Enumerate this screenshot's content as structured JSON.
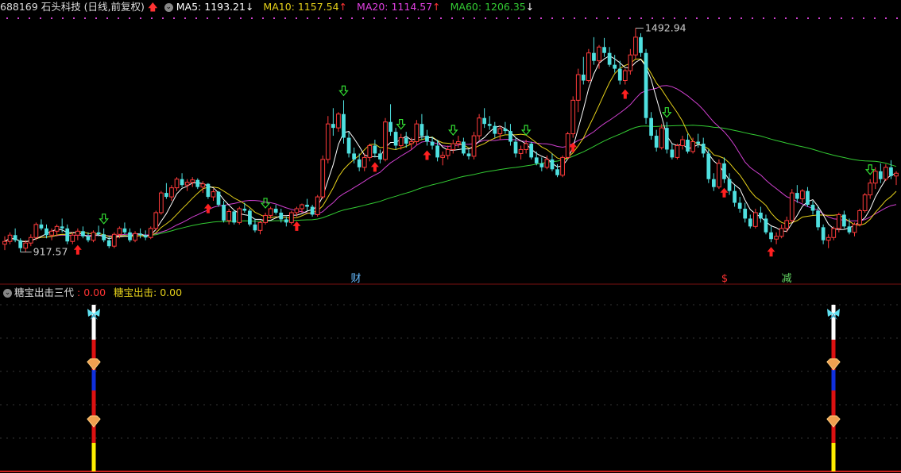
{
  "header": {
    "stock": "688169 石头科技 (日线,前复权)",
    "ma": [
      {
        "label": "MA5: 1193.21",
        "color": "#ffffff",
        "arrow": "↓",
        "arrow_color": "#ffffff"
      },
      {
        "label": "MA10: 1157.54",
        "color": "#e6d11a",
        "arrow": "↑",
        "arrow_color": "#ff3333"
      },
      {
        "label": "MA20: 1114.57",
        "color": "#e040e0",
        "arrow": "↑",
        "arrow_color": "#ff3333"
      },
      {
        "label": "MA60: 1206.35",
        "color": "#33cc33",
        "arrow": "↓",
        "arrow_color": "#ffffff"
      }
    ]
  },
  "indicator_header": {
    "name": "糖宝出击三代",
    "v1_label": "0.00",
    "v2_name": "糖宝出击:",
    "v2_label": "0.00"
  },
  "markers": [
    {
      "text": "财",
      "color": "#66bbff"
    },
    {
      "text": "$",
      "color": "#ff3333"
    },
    {
      "text": "减",
      "color": "#66dd66"
    }
  ],
  "chart_data": {
    "type": "candlestick",
    "ylim": [
      880,
      1520
    ],
    "annotations": [
      {
        "label": "1492.94",
        "type": "high"
      },
      {
        "label": "917.57",
        "type": "low"
      }
    ],
    "candles": [
      [
        945,
        965,
        930,
        952
      ],
      [
        952,
        975,
        945,
        968
      ],
      [
        968,
        985,
        950,
        955
      ],
      [
        955,
        960,
        925,
        935
      ],
      [
        935,
        955,
        925,
        948
      ],
      [
        948,
        970,
        940,
        962
      ],
      [
        962,
        1000,
        955,
        995
      ],
      [
        995,
        1008,
        980,
        985
      ],
      [
        985,
        995,
        960,
        968
      ],
      [
        968,
        985,
        955,
        978
      ],
      [
        978,
        995,
        965,
        990
      ],
      [
        990,
        1010,
        975,
        985
      ],
      [
        985,
        995,
        945,
        952
      ],
      [
        952,
        975,
        945,
        968
      ],
      [
        968,
        985,
        955,
        978
      ],
      [
        978,
        990,
        960,
        965
      ],
      [
        965,
        975,
        950,
        955
      ],
      [
        955,
        980,
        950,
        975
      ],
      [
        975,
        992,
        965,
        970
      ],
      [
        970,
        985,
        950,
        955
      ],
      [
        955,
        965,
        935,
        940
      ],
      [
        940,
        975,
        935,
        970
      ],
      [
        970,
        990,
        960,
        985
      ],
      [
        985,
        1000,
        970,
        975
      ],
      [
        975,
        985,
        950,
        955
      ],
      [
        955,
        978,
        950,
        972
      ],
      [
        972,
        985,
        960,
        968
      ],
      [
        968,
        980,
        955,
        962
      ],
      [
        962,
        990,
        958,
        985
      ],
      [
        985,
        1030,
        980,
        1025
      ],
      [
        1025,
        1080,
        1020,
        1075
      ],
      [
        1075,
        1100,
        1060,
        1065
      ],
      [
        1065,
        1095,
        1055,
        1088
      ],
      [
        1088,
        1115,
        1080,
        1110
      ],
      [
        1110,
        1125,
        1090,
        1095
      ],
      [
        1095,
        1110,
        1080,
        1102
      ],
      [
        1102,
        1115,
        1090,
        1108
      ],
      [
        1108,
        1112,
        1085,
        1090
      ],
      [
        1090,
        1105,
        1075,
        1098
      ],
      [
        1098,
        1100,
        1060,
        1065
      ],
      [
        1065,
        1085,
        1055,
        1078
      ],
      [
        1078,
        1080,
        1040,
        1045
      ],
      [
        1045,
        1055,
        1000,
        1005
      ],
      [
        1005,
        1035,
        995,
        1028
      ],
      [
        1028,
        1032,
        995,
        1000
      ],
      [
        1000,
        1040,
        995,
        1035
      ],
      [
        1035,
        1050,
        1025,
        1030
      ],
      [
        1030,
        1035,
        990,
        995
      ],
      [
        995,
        1010,
        975,
        980
      ],
      [
        980,
        1005,
        970,
        1000
      ],
      [
        1000,
        1025,
        995,
        1018
      ],
      [
        1018,
        1040,
        1010,
        1035
      ],
      [
        1035,
        1045,
        1020,
        1025
      ],
      [
        1025,
        1035,
        1000,
        1008
      ],
      [
        1008,
        1015,
        990,
        1000
      ],
      [
        1000,
        1030,
        995,
        1025
      ],
      [
        1025,
        1040,
        1015,
        1035
      ],
      [
        1035,
        1048,
        1025,
        1045
      ],
      [
        1045,
        1060,
        1030,
        1040
      ],
      [
        1040,
        1045,
        1015,
        1020
      ],
      [
        1020,
        1070,
        1015,
        1065
      ],
      [
        1065,
        1170,
        1060,
        1160
      ],
      [
        1160,
        1270,
        1150,
        1250
      ],
      [
        1250,
        1290,
        1220,
        1240
      ],
      [
        1240,
        1280,
        1230,
        1275
      ],
      [
        1275,
        1310,
        1200,
        1215
      ],
      [
        1215,
        1230,
        1165,
        1175
      ],
      [
        1175,
        1190,
        1150,
        1160
      ],
      [
        1160,
        1175,
        1130,
        1140
      ],
      [
        1140,
        1175,
        1130,
        1165
      ],
      [
        1165,
        1200,
        1155,
        1195
      ],
      [
        1195,
        1210,
        1165,
        1175
      ],
      [
        1175,
        1185,
        1150,
        1160
      ],
      [
        1160,
        1265,
        1155,
        1255
      ],
      [
        1255,
        1300,
        1220,
        1230
      ],
      [
        1230,
        1240,
        1185,
        1195
      ],
      [
        1195,
        1225,
        1185,
        1215
      ],
      [
        1215,
        1230,
        1190,
        1200
      ],
      [
        1200,
        1215,
        1185,
        1205
      ],
      [
        1205,
        1260,
        1195,
        1250
      ],
      [
        1250,
        1275,
        1210,
        1220
      ],
      [
        1220,
        1235,
        1195,
        1205
      ],
      [
        1205,
        1218,
        1185,
        1195
      ],
      [
        1195,
        1210,
        1155,
        1165
      ],
      [
        1165,
        1180,
        1145,
        1170
      ],
      [
        1170,
        1195,
        1160,
        1185
      ],
      [
        1185,
        1210,
        1175,
        1200
      ],
      [
        1200,
        1220,
        1190,
        1205
      ],
      [
        1205,
        1215,
        1170,
        1175
      ],
      [
        1175,
        1185,
        1160,
        1168
      ],
      [
        1168,
        1230,
        1160,
        1220
      ],
      [
        1220,
        1275,
        1210,
        1265
      ],
      [
        1265,
        1290,
        1240,
        1250
      ],
      [
        1250,
        1270,
        1235,
        1245
      ],
      [
        1245,
        1255,
        1215,
        1225
      ],
      [
        1225,
        1245,
        1210,
        1238
      ],
      [
        1238,
        1255,
        1225,
        1232
      ],
      [
        1232,
        1250,
        1195,
        1205
      ],
      [
        1205,
        1215,
        1165,
        1175
      ],
      [
        1175,
        1195,
        1160,
        1185
      ],
      [
        1185,
        1210,
        1175,
        1200
      ],
      [
        1200,
        1205,
        1160,
        1165
      ],
      [
        1165,
        1180,
        1145,
        1150
      ],
      [
        1150,
        1165,
        1130,
        1140
      ],
      [
        1140,
        1170,
        1135,
        1160
      ],
      [
        1160,
        1175,
        1130,
        1135
      ],
      [
        1135,
        1148,
        1115,
        1120
      ],
      [
        1120,
        1170,
        1115,
        1165
      ],
      [
        1165,
        1230,
        1160,
        1225
      ],
      [
        1225,
        1320,
        1215,
        1310
      ],
      [
        1310,
        1390,
        1280,
        1375
      ],
      [
        1375,
        1420,
        1350,
        1360
      ],
      [
        1360,
        1440,
        1355,
        1430
      ],
      [
        1430,
        1470,
        1400,
        1410
      ],
      [
        1410,
        1450,
        1390,
        1445
      ],
      [
        1445,
        1468,
        1420,
        1430
      ],
      [
        1430,
        1445,
        1395,
        1400
      ],
      [
        1400,
        1425,
        1380,
        1390
      ],
      [
        1390,
        1410,
        1350,
        1360
      ],
      [
        1360,
        1390,
        1350,
        1385
      ],
      [
        1385,
        1440,
        1375,
        1425
      ],
      [
        1425,
        1493,
        1415,
        1470
      ],
      [
        1470,
        1480,
        1420,
        1430
      ],
      [
        1430,
        1440,
        1250,
        1265
      ],
      [
        1265,
        1280,
        1210,
        1220
      ],
      [
        1220,
        1235,
        1180,
        1190
      ],
      [
        1190,
        1250,
        1185,
        1240
      ],
      [
        1240,
        1255,
        1175,
        1185
      ],
      [
        1185,
        1200,
        1160,
        1165
      ],
      [
        1165,
        1200,
        1160,
        1195
      ],
      [
        1195,
        1220,
        1185,
        1210
      ],
      [
        1210,
        1225,
        1175,
        1180
      ],
      [
        1180,
        1215,
        1175,
        1205
      ],
      [
        1205,
        1225,
        1190,
        1200
      ],
      [
        1200,
        1215,
        1165,
        1175
      ],
      [
        1175,
        1185,
        1100,
        1110
      ],
      [
        1110,
        1125,
        1080,
        1090
      ],
      [
        1090,
        1160,
        1085,
        1150
      ],
      [
        1150,
        1165,
        1100,
        1110
      ],
      [
        1110,
        1125,
        1070,
        1080
      ],
      [
        1080,
        1095,
        1040,
        1050
      ],
      [
        1050,
        1065,
        1025,
        1035
      ],
      [
        1035,
        1050,
        1000,
        1010
      ],
      [
        1010,
        1020,
        985,
        990
      ],
      [
        990,
        1035,
        985,
        1025
      ],
      [
        1025,
        1040,
        1000,
        1010
      ],
      [
        1010,
        1020,
        970,
        975
      ],
      [
        975,
        990,
        950,
        958
      ],
      [
        958,
        975,
        945,
        965
      ],
      [
        965,
        995,
        960,
        985
      ],
      [
        985,
        1015,
        975,
        1005
      ],
      [
        1005,
        1085,
        1000,
        1075
      ],
      [
        1075,
        1095,
        1050,
        1060
      ],
      [
        1060,
        1085,
        1050,
        1080
      ],
      [
        1080,
        1090,
        1040,
        1045
      ],
      [
        1045,
        1055,
        1020,
        1030
      ],
      [
        1030,
        1040,
        980,
        988
      ],
      [
        988,
        995,
        945,
        955
      ],
      [
        955,
        970,
        935,
        962
      ],
      [
        962,
        990,
        955,
        985
      ],
      [
        985,
        1025,
        975,
        1020
      ],
      [
        1020,
        1030,
        985,
        990
      ],
      [
        990,
        1010,
        970,
        975
      ],
      [
        975,
        1000,
        965,
        995
      ],
      [
        995,
        1035,
        990,
        1030
      ],
      [
        1030,
        1075,
        1025,
        1070
      ],
      [
        1070,
        1110,
        1060,
        1100
      ],
      [
        1100,
        1140,
        1085,
        1130
      ],
      [
        1130,
        1150,
        1100,
        1110
      ],
      [
        1110,
        1148,
        1105,
        1140
      ],
      [
        1140,
        1158,
        1110,
        1118
      ],
      [
        1118,
        1130,
        1095,
        1125
      ]
    ],
    "up_signals": [
      14,
      39,
      56,
      71,
      81,
      109,
      119,
      138,
      147,
      190,
      202,
      232,
      241,
      258
    ],
    "down_signals": [
      19,
      50,
      65,
      76,
      86,
      100,
      127,
      166,
      175,
      196,
      263
    ],
    "sub_signals": [
      {
        "index": 14
      },
      {
        "index": 253
      }
    ]
  }
}
